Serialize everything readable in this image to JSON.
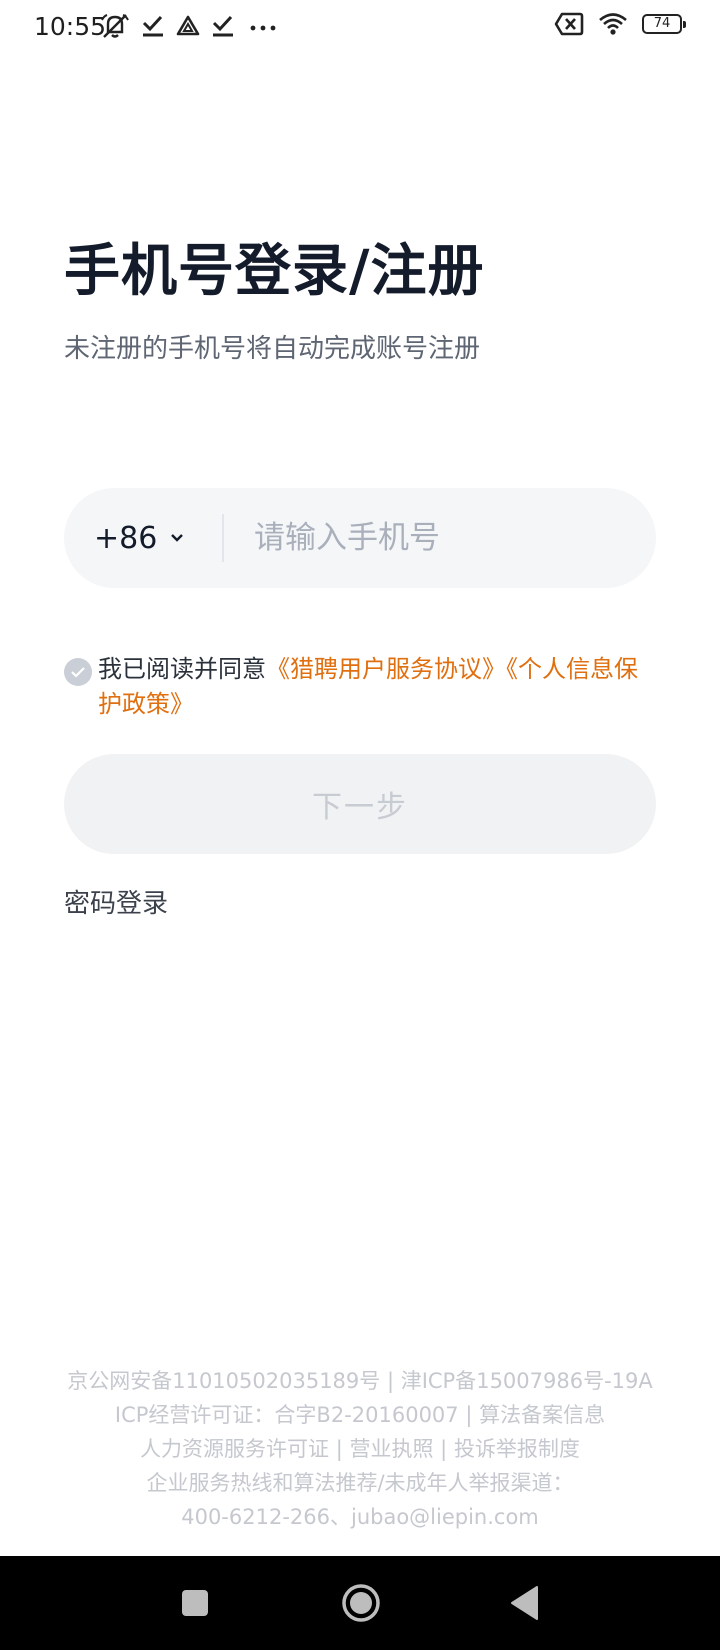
{
  "status_bar": {
    "time": "10:55",
    "battery": "74",
    "icons": [
      "mute-icon",
      "check-icon",
      "triangle-icon",
      "check-icon",
      "more-dots-icon",
      "sim-x-icon",
      "wifi-icon",
      "battery-icon"
    ]
  },
  "header": {
    "title": "手机号登录/注册",
    "subtitle": "未注册的手机号将自动完成账号注册"
  },
  "phone_input": {
    "country_code": "+86",
    "placeholder": "请输入手机号",
    "value": ""
  },
  "agreement": {
    "prefix": "我已阅读并同意",
    "link_user_agreement": "《猎聘用户服务协议》",
    "link_privacy_policy": "《个人信息保护政策》",
    "checked": false
  },
  "buttons": {
    "next": "下一步",
    "password_login": "密码登录"
  },
  "footer": {
    "line1": "京公网安备11010502035189号 | 津ICP备15007986号-19A",
    "line2_prefix": "ICP经营许可证：合字B2-20160007 | ",
    "line2_link": "算法备案信息",
    "line3_link1": "人力资源服务许可证",
    "line3_sep1": " | ",
    "line3_link2": "营业执照",
    "line3_sep2": " | ",
    "line3_link3": "投诉举报制度",
    "line4": "企业服务热线和算法推荐/未成年人举报渠道：",
    "line5": "400-6212-266、jubao@liepin.com"
  },
  "colors": {
    "accent_link": "#e06f10",
    "title": "#141b2a",
    "input_bg": "#f5f6f8",
    "button_disabled_bg": "#f1f2f4"
  }
}
